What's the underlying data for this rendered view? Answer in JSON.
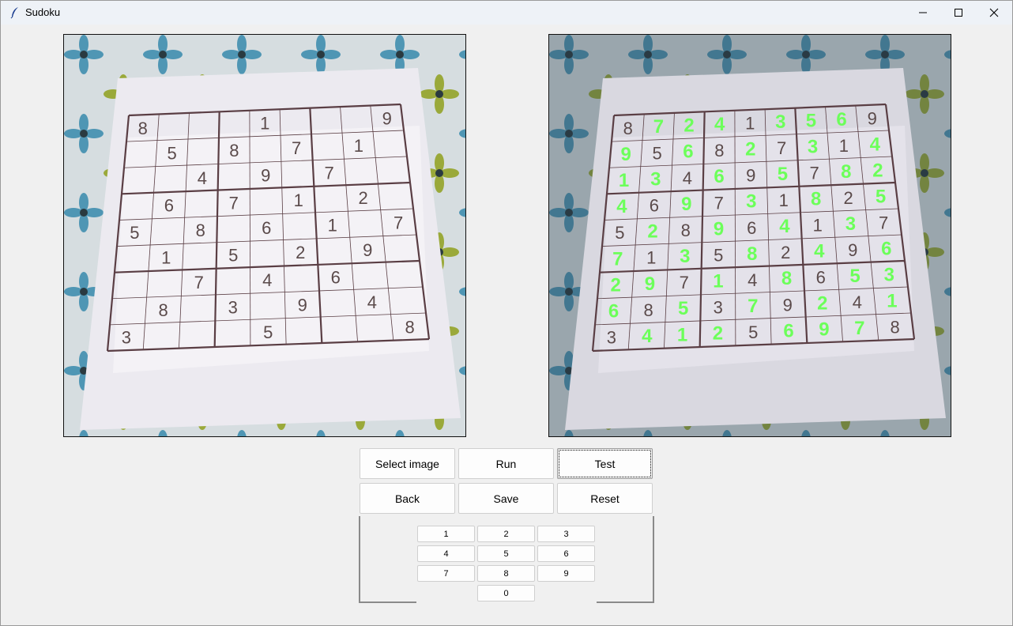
{
  "window": {
    "title": "Sudoku",
    "app_icon": "feather-icon",
    "controls": [
      "minimize-icon",
      "maximize-icon",
      "close-icon"
    ]
  },
  "input_image": {
    "grid": [
      [
        "8",
        "",
        "",
        "",
        "1",
        "",
        "",
        "",
        "9"
      ],
      [
        "",
        "5",
        "",
        "8",
        "",
        "7",
        "",
        "1",
        ""
      ],
      [
        "",
        "",
        "4",
        "",
        "9",
        "",
        "7",
        "",
        ""
      ],
      [
        "",
        "6",
        "",
        "7",
        "",
        "1",
        "",
        "2",
        ""
      ],
      [
        "5",
        "",
        "8",
        "",
        "6",
        "",
        "1",
        "",
        "7"
      ],
      [
        "",
        "1",
        "",
        "5",
        "",
        "2",
        "",
        "9",
        ""
      ],
      [
        "",
        "",
        "7",
        "",
        "4",
        "",
        "6",
        "",
        ""
      ],
      [
        "",
        "8",
        "",
        "3",
        "",
        "9",
        "",
        "4",
        ""
      ],
      [
        "3",
        "",
        "",
        "",
        "5",
        "",
        "",
        "",
        "8"
      ]
    ]
  },
  "output_image": {
    "grid": [
      [
        "8",
        "7",
        "2",
        "4",
        "1",
        "3",
        "5",
        "6",
        "9"
      ],
      [
        "9",
        "5",
        "6",
        "8",
        "2",
        "7",
        "3",
        "1",
        "4"
      ],
      [
        "1",
        "3",
        "4",
        "6",
        "9",
        "5",
        "7",
        "8",
        "2"
      ],
      [
        "4",
        "6",
        "9",
        "7",
        "3",
        "1",
        "8",
        "2",
        "5"
      ],
      [
        "5",
        "2",
        "8",
        "9",
        "6",
        "4",
        "1",
        "3",
        "7"
      ],
      [
        "7",
        "1",
        "3",
        "5",
        "8",
        "2",
        "4",
        "9",
        "6"
      ],
      [
        "2",
        "9",
        "7",
        "1",
        "4",
        "8",
        "6",
        "5",
        "3"
      ],
      [
        "6",
        "8",
        "5",
        "3",
        "7",
        "9",
        "2",
        "4",
        "1"
      ],
      [
        "3",
        "4",
        "1",
        "2",
        "5",
        "6",
        "9",
        "7",
        "8"
      ]
    ],
    "given_color": "#5a4a4a",
    "solved_color": "#6cff5a"
  },
  "buttons": {
    "select_image": "Select image",
    "run": "Run",
    "test": "Test",
    "back": "Back",
    "save": "Save",
    "reset": "Reset"
  },
  "keypad": [
    "1",
    "2",
    "3",
    "4",
    "5",
    "6",
    "7",
    "8",
    "9",
    "0"
  ]
}
